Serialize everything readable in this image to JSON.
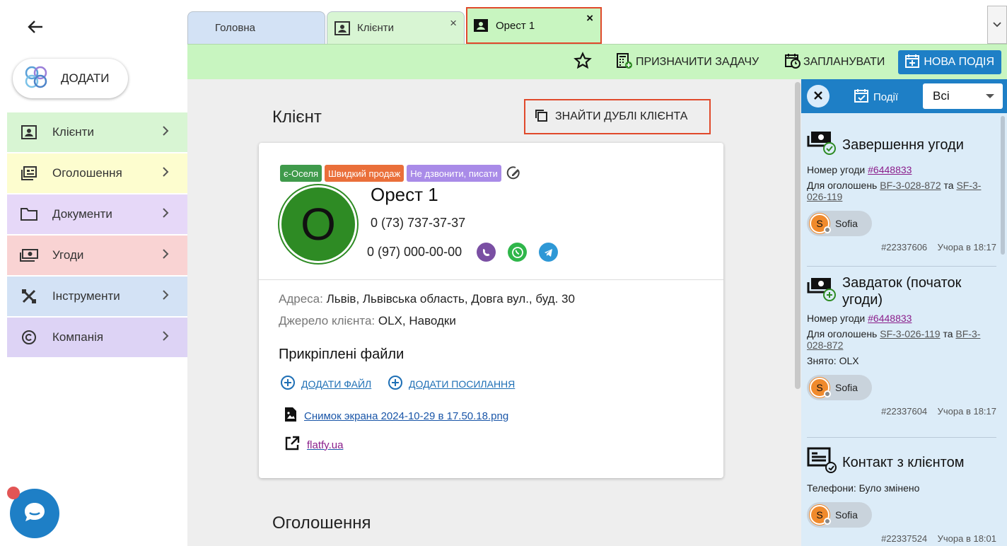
{
  "sidebar": {
    "add_label": "ДОДАТИ",
    "items": [
      {
        "label": "Клієнти",
        "bg": "#d8f5d3",
        "icon": "contacts-icon"
      },
      {
        "label": "Оголошення",
        "bg": "#fdfdcf",
        "icon": "listings-icon"
      },
      {
        "label": "Документи",
        "bg": "#e6d8f8",
        "icon": "folder-icon"
      },
      {
        "label": "Угоди",
        "bg": "#f9d3d3",
        "icon": "money-icon"
      },
      {
        "label": "Інструменти",
        "bg": "#d3e2f5",
        "icon": "tools-icon"
      },
      {
        "label": "Компанія",
        "bg": "#ddd3f5",
        "icon": "copyright-icon"
      }
    ]
  },
  "tabs": {
    "home": "Головна",
    "clients": "Клієнти",
    "active": "Орест 1",
    "close": "×"
  },
  "toolbar": {
    "assign": "ПРИЗНАЧИТИ ЗАДАЧУ",
    "schedule": "ЗАПЛАНУВАТИ",
    "new_event": "НОВА ПОДІЯ"
  },
  "client": {
    "section_title": "Клієнт",
    "find_duplicates": "ЗНАЙТИ ДУБЛІ КЛІЄНТА",
    "tags": [
      {
        "label": "є-Оселя",
        "color": "#3f9a4b"
      },
      {
        "label": "Швидкий продаж",
        "color": "#ea6f3a"
      },
      {
        "label": "Не дзвонити, писати",
        "color": "#a98be8"
      }
    ],
    "avatar_letter": "O",
    "name": "Орест 1",
    "phone1": "0 (73) 737-37-37",
    "phone2": "0 (97) 000-00-00",
    "address_label": "Адреса:",
    "address": "Львів, Львівська область, Довга вул., буд. 30",
    "source_label": "Джерело клієнта:",
    "source": "OLX, Наводки",
    "files_title": "Прикріплені файли",
    "add_file": "ДОДАТИ ФАЙЛ",
    "add_link": "ДОДАТИ ПОСИЛАННЯ",
    "file_name": "Снимок экрана 2024-10-29 в 17.50.18.png",
    "link_name": "flatfy.ua"
  },
  "ads_title": "Оголошення",
  "events_panel": {
    "title": "Події",
    "filter": "Всі",
    "events": [
      {
        "title": "Завершення угоди",
        "deal_label": "Номер угоди",
        "deal": "#6448833",
        "ads_label": "Для оголошень",
        "ad1": "BF-3-028-872",
        "and": "та",
        "ad2": "SF-3-026-119",
        "user": "Sofia",
        "user_letter": "S",
        "id": "#22337606",
        "time": "Учора в 18:17"
      },
      {
        "title": "Завдаток (початок угоди)",
        "deal_label": "Номер угоди",
        "deal": "#6448833",
        "ads_label": "Для оголошень",
        "ad1": "SF-3-026-119",
        "and": "та",
        "ad2": "BF-3-028-872",
        "extra": "Знято: OLX",
        "user": "Sofia",
        "user_letter": "S",
        "id": "#22337604",
        "time": "Учора в 18:17"
      },
      {
        "title": "Контакт з клієнтом",
        "line": "Телефони: Було змінено",
        "user": "Sofia",
        "user_letter": "S",
        "id": "#22337524",
        "time": "Учора в 18:01"
      }
    ]
  }
}
